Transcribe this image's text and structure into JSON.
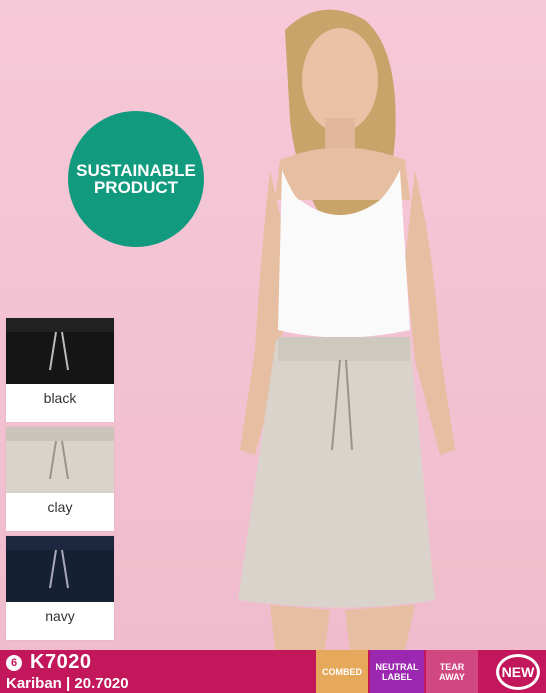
{
  "badge": {
    "line1": "SUSTAINABLE",
    "line2": "PRODUCT",
    "color": "#119a7d"
  },
  "swatches": [
    {
      "label": "black",
      "color": "#151515"
    },
    {
      "label": "clay",
      "color": "#d9d3cb"
    },
    {
      "label": "navy",
      "color": "#162033"
    }
  ],
  "product": {
    "number": "6",
    "code": "K7020",
    "subtitle": "Kariban | 20.7020"
  },
  "tags": {
    "combed": "COMBED",
    "neutral_line1": "NEUTRAL",
    "neutral_line2": "LABEL",
    "tear_line1": "TEAR",
    "tear_line2": "AWAY",
    "new": "NEW"
  },
  "colors": {
    "brand": "#c2185b",
    "background": "#f2c2d2"
  }
}
